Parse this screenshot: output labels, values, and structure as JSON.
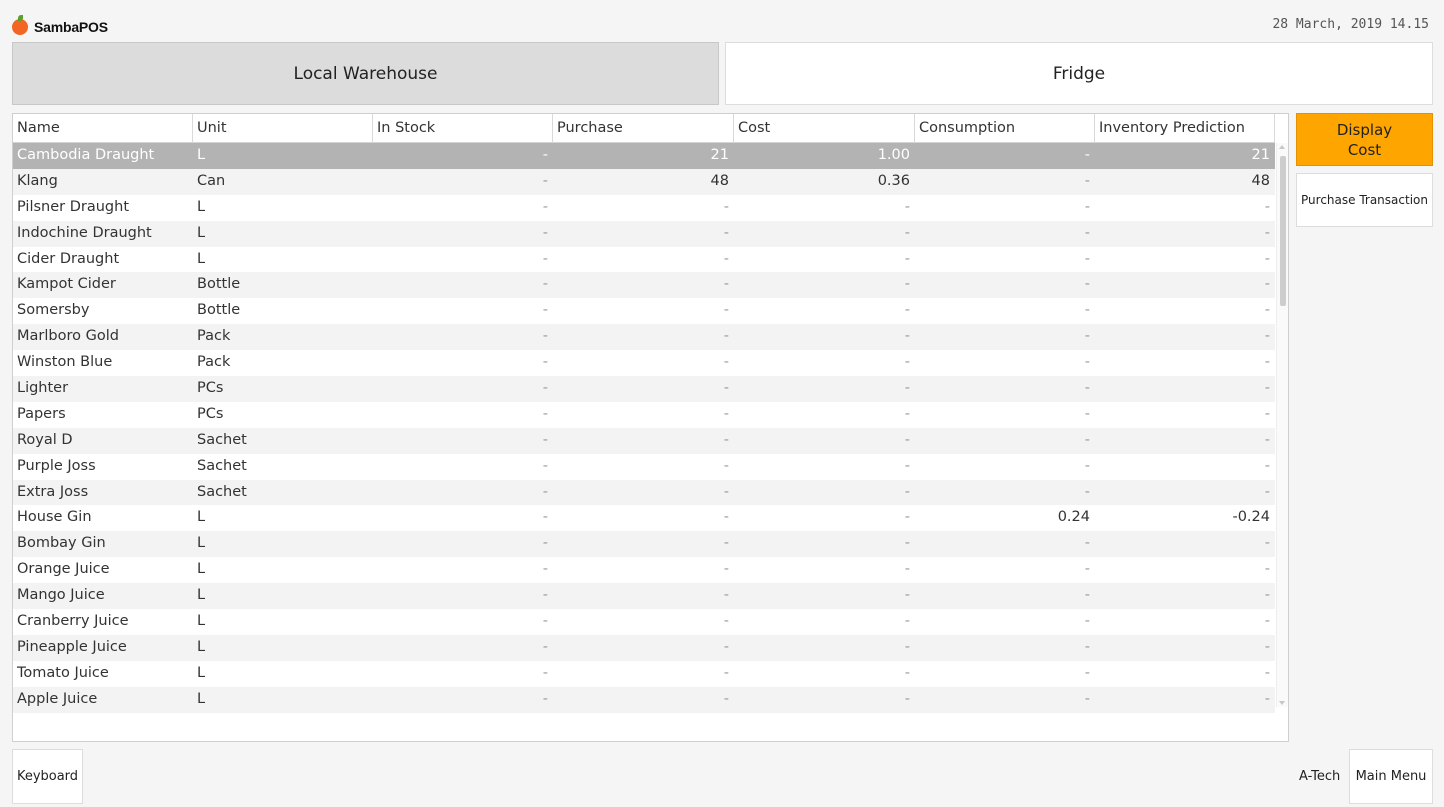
{
  "app": {
    "name": "SambaPOS",
    "datetime": "28 March, 2019 14.15"
  },
  "warehouses": [
    {
      "label": "Local Warehouse",
      "selected": true
    },
    {
      "label": "Fridge",
      "selected": false
    }
  ],
  "grid": {
    "columns": [
      "Name",
      "Unit",
      "In Stock",
      "Purchase",
      "Cost",
      "Consumption",
      "Inventory Prediction"
    ],
    "rows": [
      [
        "Cambodia Draught",
        "L",
        "",
        "-",
        "21",
        "1.00",
        "-",
        "21"
      ],
      [
        "Klang",
        "Can",
        "",
        "-",
        "48",
        "0.36",
        "-",
        "48"
      ],
      [
        "Pilsner Draught",
        "L",
        "",
        "-",
        "-",
        "-",
        "-",
        "-"
      ],
      [
        "Indochine Draught",
        "L",
        "",
        "-",
        "-",
        "-",
        "-",
        "-"
      ],
      [
        "Cider Draught",
        "L",
        "",
        "-",
        "-",
        "-",
        "-",
        "-"
      ],
      [
        "Kampot Cider",
        "Bottle",
        "",
        "-",
        "-",
        "-",
        "-",
        "-"
      ],
      [
        "Somersby",
        "Bottle",
        "",
        "-",
        "-",
        "-",
        "-",
        "-"
      ],
      [
        "Marlboro Gold",
        "Pack",
        "",
        "-",
        "-",
        "-",
        "-",
        "-"
      ],
      [
        "Winston Blue",
        "Pack",
        "",
        "-",
        "-",
        "-",
        "-",
        "-"
      ],
      [
        "Lighter",
        "PCs",
        "",
        "-",
        "-",
        "-",
        "-",
        "-"
      ],
      [
        "Papers",
        "PCs",
        "",
        "-",
        "-",
        "-",
        "-",
        "-"
      ],
      [
        "Royal D",
        "Sachet",
        "",
        "-",
        "-",
        "-",
        "-",
        "-"
      ],
      [
        "Purple Joss",
        "Sachet",
        "",
        "-",
        "-",
        "-",
        "-",
        "-"
      ],
      [
        "Extra Joss",
        "Sachet",
        "",
        "-",
        "-",
        "-",
        "-",
        "-"
      ],
      [
        "House Gin",
        "L",
        "",
        "-",
        "-",
        "-",
        "0.24",
        "-0.24"
      ],
      [
        "Bombay Gin",
        "L",
        "",
        "-",
        "-",
        "-",
        "-",
        "-"
      ],
      [
        "Orange Juice",
        "L",
        "",
        "-",
        "-",
        "-",
        "-",
        "-"
      ],
      [
        "Mango Juice",
        "L",
        "",
        "-",
        "-",
        "-",
        "-",
        "-"
      ],
      [
        "Cranberry Juice",
        "L",
        "",
        "-",
        "-",
        "-",
        "-",
        "-"
      ],
      [
        "Pineapple Juice",
        "L",
        "",
        "-",
        "-",
        "-",
        "-",
        "-"
      ],
      [
        "Tomato Juice",
        "L",
        "",
        "-",
        "-",
        "-",
        "-",
        "-"
      ],
      [
        "Apple Juice",
        "L",
        "",
        "-",
        "-",
        "-",
        "-",
        "-"
      ]
    ],
    "selected_row": 0
  },
  "side_buttons": {
    "display_cost": "Display\nCost",
    "purchase_transaction": "Purchase Transaction"
  },
  "footer": {
    "keyboard": "Keyboard",
    "user": "A-Tech",
    "main_menu": "Main Menu"
  },
  "colors": {
    "accent": "#ffa500",
    "selected_row": "#b3b3b3"
  }
}
